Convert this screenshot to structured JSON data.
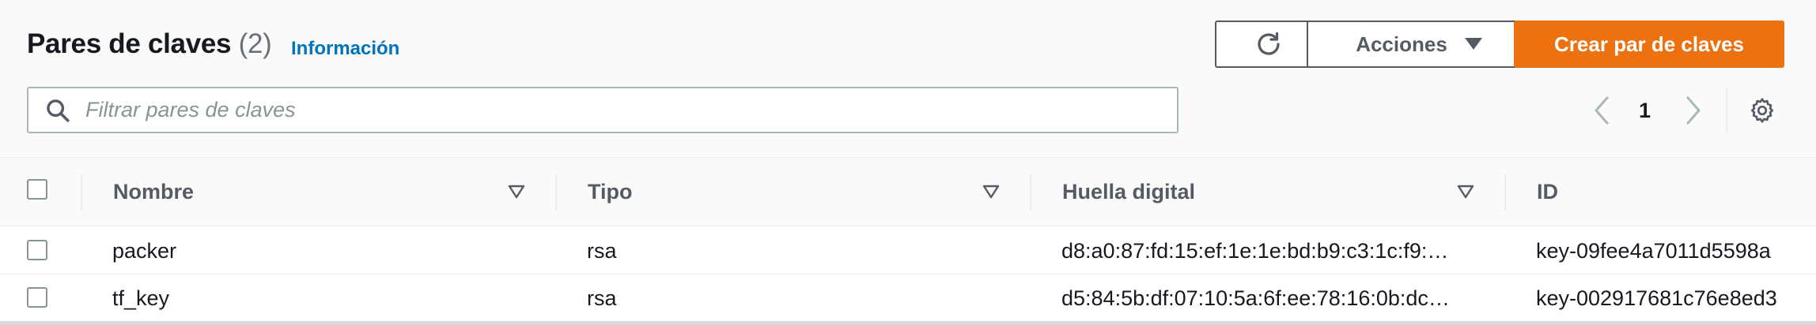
{
  "header": {
    "title": "Pares de claves",
    "count": "(2)",
    "info_link": "Información"
  },
  "toolbar": {
    "refresh_icon": "refresh-icon",
    "actions_label": "Acciones",
    "create_label": "Crear par de claves",
    "accent_color": "#ec7211"
  },
  "search": {
    "placeholder": "Filtrar pares de claves"
  },
  "pagination": {
    "current_page": "1"
  },
  "table": {
    "columns": [
      "Nombre",
      "Tipo",
      "Huella digital",
      "ID"
    ],
    "rows": [
      {
        "name": "packer",
        "type": "rsa",
        "fingerprint": "d8:a0:87:fd:15:ef:1e:1e:bd:b9:c3:1c:f9:…",
        "id": "key-09fee4a7011d5598a"
      },
      {
        "name": "tf_key",
        "type": "rsa",
        "fingerprint": "d5:84:5b:df:07:10:5a:6f:ee:78:16:0b:dc…",
        "id": "key-002917681c76e8ed3"
      }
    ]
  }
}
